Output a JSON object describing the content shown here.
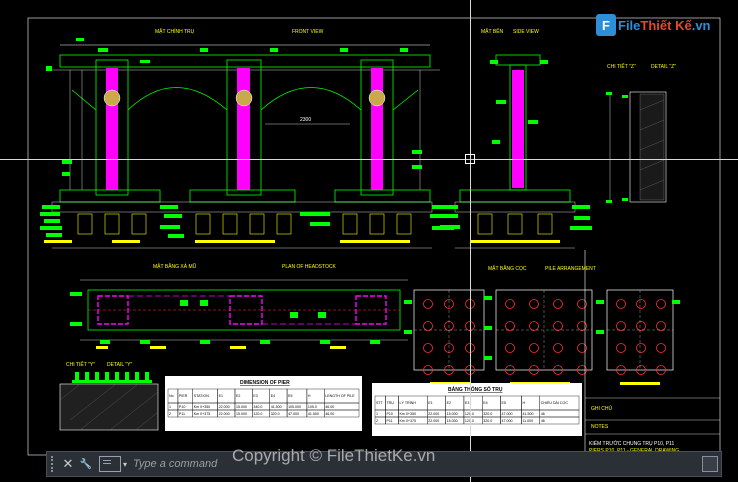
{
  "drawing": {
    "front_view_title_vn": "MẶT CHÍNH TRỤ",
    "front_view_title_en": "FRONT VIEW",
    "side_view_title_vn": "MẶT BÊN",
    "side_view_title_en": "SIDE VIEW",
    "detail_title_vn": "CHI TIẾT \"Z\"",
    "detail_title_en": "DETAIL \"Z\"",
    "headstock_title_vn": "MẶT BẰNG XÀ MŨ",
    "headstock_title_en": "PLAN OF HEADSTOCK",
    "pile_title_vn": "MẶT BẰNG CỌC",
    "pile_title_en": "PILE ARRANGEMENT",
    "detail2_title_vn": "CHI TIẾT \"Y\"",
    "detail2_title_en": "DETAIL \"Y\"",
    "dimension_value": "2300"
  },
  "table_pier": {
    "title": "DIMENSION OF PIER",
    "headers": [
      "No",
      "PIER",
      "STATION",
      "E1",
      "E2",
      "E3",
      "E4",
      "E5",
      "H",
      "LENGTH OF PILE (CAST IN PLACE PILE D=1200)"
    ],
    "rows": [
      [
        "1",
        "P10",
        "Km 0+350",
        "22.000",
        "15.000",
        "340.0",
        "41.500",
        "105.000",
        "105.0",
        "46.00"
      ],
      [
        "2",
        "P11",
        "Km 0+375",
        "22.000",
        "15.000",
        "120.0",
        "320.0",
        "47.000",
        "41.500",
        "46.00"
      ]
    ]
  },
  "table_stats": {
    "title": "BẢNG THỐNG SỐ TRỤ",
    "headers": [
      "STT",
      "TRỤ",
      "LÝ TRÌNH",
      "E1",
      "E2",
      "E3",
      "E4",
      "E5",
      "H",
      "CHIỀU DÀI CỌC KHOAN NHỒI D=1200"
    ],
    "rows": [
      [
        "1",
        "P10",
        "Km 0+350",
        "22.000",
        "15.000",
        "120.0",
        "320.0",
        "47.000",
        "41.500",
        "46"
      ],
      [
        "2",
        "P11",
        "Km 0+375",
        "22.000",
        "15.000",
        "120.0",
        "320.0",
        "47.000",
        "11.000",
        "46"
      ]
    ]
  },
  "title_block": {
    "label_a": "GHI CHÚ",
    "label_b": "NOTES",
    "caption_line1": "KIỂM TRƯỚC CHUNG TRỤ P10, P11",
    "caption_line2": "PIERS P10, P11 - GENERAL DRAWING"
  },
  "logo": {
    "mark": "F",
    "text_a": "File",
    "text_b": "Thiết Kế",
    "text_c": ".vn"
  },
  "watermark": "Copyright © FileThietKe.vn",
  "command_line": {
    "placeholder": "Type a command",
    "close_glyph": "✕",
    "settings_glyph": "🔧",
    "chevron": "▾"
  },
  "colors": {
    "background": "#000000",
    "pier": "#ff00ff",
    "outline": "#00ff00",
    "label": "#ffff00",
    "dimension": "#ffffff",
    "pile": "#ff3030"
  }
}
